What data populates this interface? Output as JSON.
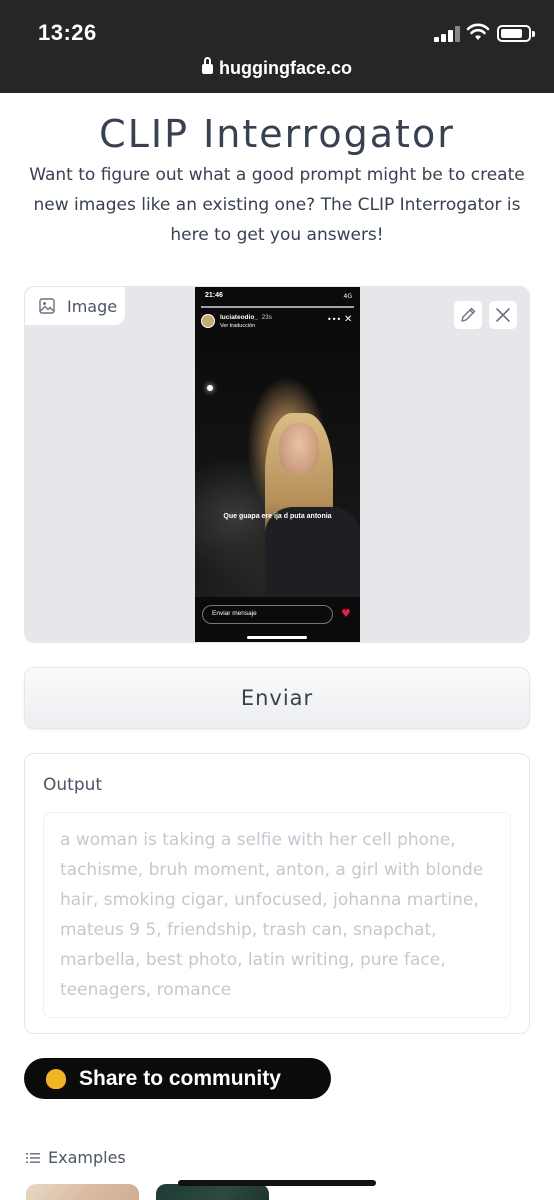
{
  "status_bar": {
    "time": "13:26",
    "domain": "huggingface.co"
  },
  "header": {
    "title": "CLIP Interrogator",
    "description": "Want to figure out what a good prompt might be to create new images like an existing one? The CLIP Interrogator is here to get you answers!"
  },
  "image_input": {
    "label": "Image",
    "icon": "image-icon",
    "edit_icon": "pencil-icon",
    "clear_icon": "close-icon",
    "uploaded_screenshot": {
      "time": "21:46",
      "network": "4G",
      "username": "luciateodio_",
      "age": "23s",
      "subtitle": "Ver traducción",
      "caption": "Que guapa ere ija d puta antonia",
      "message_placeholder": "Enviar mensaje"
    }
  },
  "submit_button": {
    "label": "Enviar"
  },
  "output": {
    "label": "Output",
    "text": "a woman is taking a selfie with her cell phone, tachisme, bruh moment, anton, a girl with blonde hair, smoking cigar, unfocused, johanna martine, mateus 9 5, friendship, trash can, snapchat, marbella, best photo, latin writing, pure face, teenagers, romance"
  },
  "share_button": {
    "label": "Share to community",
    "icon": "clapping-hands-icon"
  },
  "examples": {
    "label": "Examples",
    "icon": "list-icon"
  },
  "colors": {
    "status_bar_bg": "#262626",
    "panel_bg": "#e5e7eb",
    "share_bg": "#0b0b0b",
    "output_placeholder": "#c4c8cf"
  }
}
